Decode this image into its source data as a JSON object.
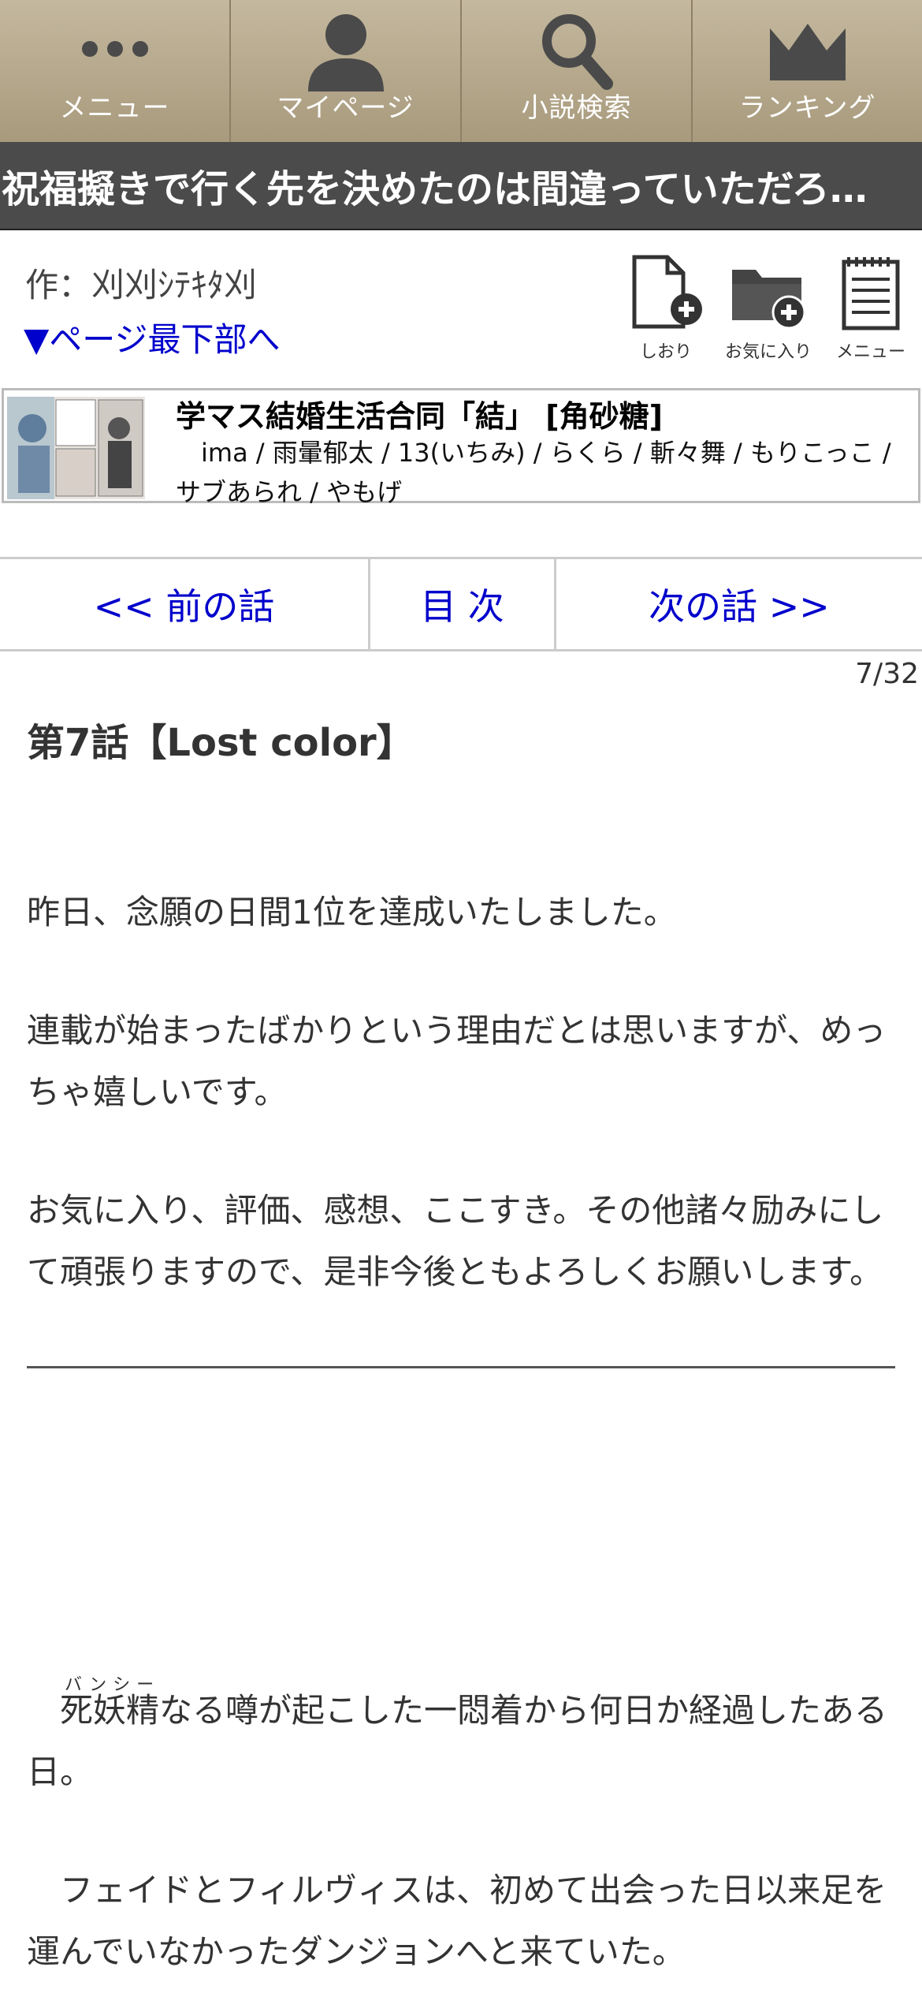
{
  "nav": {
    "items": [
      {
        "label": "メニュー",
        "icon": "dots-icon"
      },
      {
        "label": "マイページ",
        "icon": "person-icon"
      },
      {
        "label": "小説検索",
        "icon": "search-icon"
      },
      {
        "label": "ランキング",
        "icon": "crown-icon"
      }
    ]
  },
  "novel": {
    "title": "祝福擬きで行く先を決めたのは間違っていただろ…",
    "author": "作：刈刈ｼﾃｷﾀ刈",
    "jump_link": "▼ページ最下部へ"
  },
  "tools": [
    {
      "label": "しおり",
      "icon": "bookmark-add-icon"
    },
    {
      "label": "お気に入り",
      "icon": "folder-add-icon"
    },
    {
      "label": "メニュー",
      "icon": "notepad-menu-icon"
    }
  ],
  "ad": {
    "title": "学マス結婚生活合同「結」 [角砂糖]",
    "authors": "　ima / 雨暈郁太 / 13(いちみ) / らくら / 斬々舞 / もりこっこ / サブあられ / やもげ"
  },
  "chapter_nav": {
    "prev": "<< 前の話",
    "toc": "目 次",
    "next": "次の話 >>"
  },
  "page_counter": "7/32",
  "chapter": {
    "title": "第7話【Lost color】",
    "foreword": [
      "昨日、念願の日間1位を達成いたしました。",
      "連載が始まったばかりという理由だとは思いますが、めっちゃ嬉しいです。",
      "お気に入り、評価、感想、ここすき。その他諸々励みにして頑張りますので、是非今後ともよろしくお願いします。"
    ],
    "ruby_reading": "バンシー",
    "body": [
      "　死妖精なる噂が起こした一悶着から何日か経過したある日。",
      "　フェイドとフィルヴィスは、初めて出会った日以来足を運んでいなかったダンジョンへと来ていた。"
    ]
  }
}
